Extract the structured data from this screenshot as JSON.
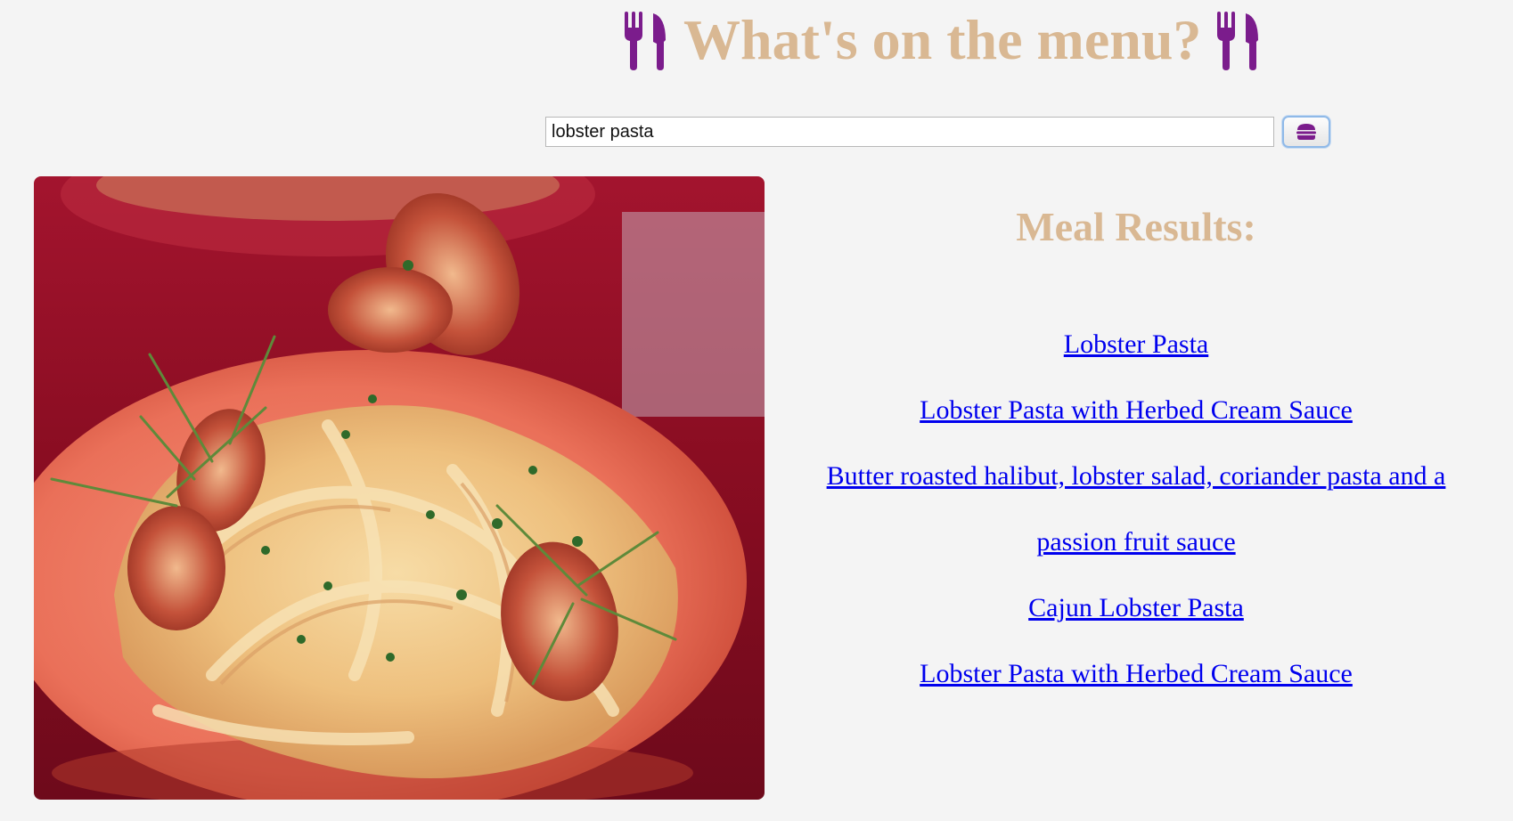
{
  "header": {
    "title": "What's on the menu?",
    "left_icon": "utensils-icon",
    "right_icon": "utensils-icon",
    "title_color": "#d9b893",
    "icon_color": "#7b1c8c"
  },
  "search": {
    "value": "lobster pasta",
    "button_icon": "hamburger-icon"
  },
  "image": {
    "subject": "lobster-pasta-photo"
  },
  "results": {
    "heading": "Meal Results:",
    "items": [
      "Lobster Pasta",
      "Lobster Pasta with Herbed Cream Sauce",
      "Butter roasted halibut, lobster salad, coriander pasta and a passion fruit sauce",
      "Cajun Lobster Pasta",
      "Lobster Pasta with Herbed Cream Sauce"
    ],
    "link_color": "#0000ee"
  }
}
